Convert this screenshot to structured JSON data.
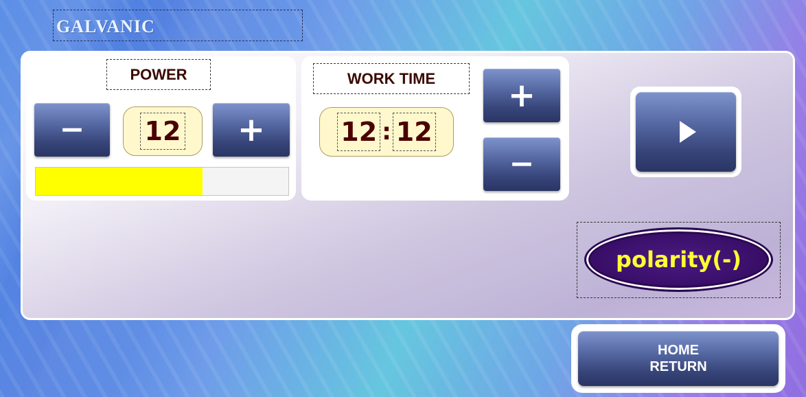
{
  "app": {
    "title": "GALVANIC"
  },
  "power": {
    "label": "POWER",
    "value": "12",
    "decrease_glyph": "−",
    "increase_glyph": "+",
    "level_fraction": 0.66,
    "bar_color": "#ffff00"
  },
  "work_time": {
    "label": "WORK TIME",
    "minutes": "12",
    "separator": ":",
    "seconds": "12",
    "increase_glyph": "+",
    "decrease_glyph": "−"
  },
  "play": {
    "icon": "play-icon"
  },
  "polarity": {
    "label": "polarity(-)",
    "fill_color": "#3a0f6a",
    "text_color": "#ffff33"
  },
  "home_return": {
    "line1": "HOME",
    "line2": "RETURN"
  }
}
